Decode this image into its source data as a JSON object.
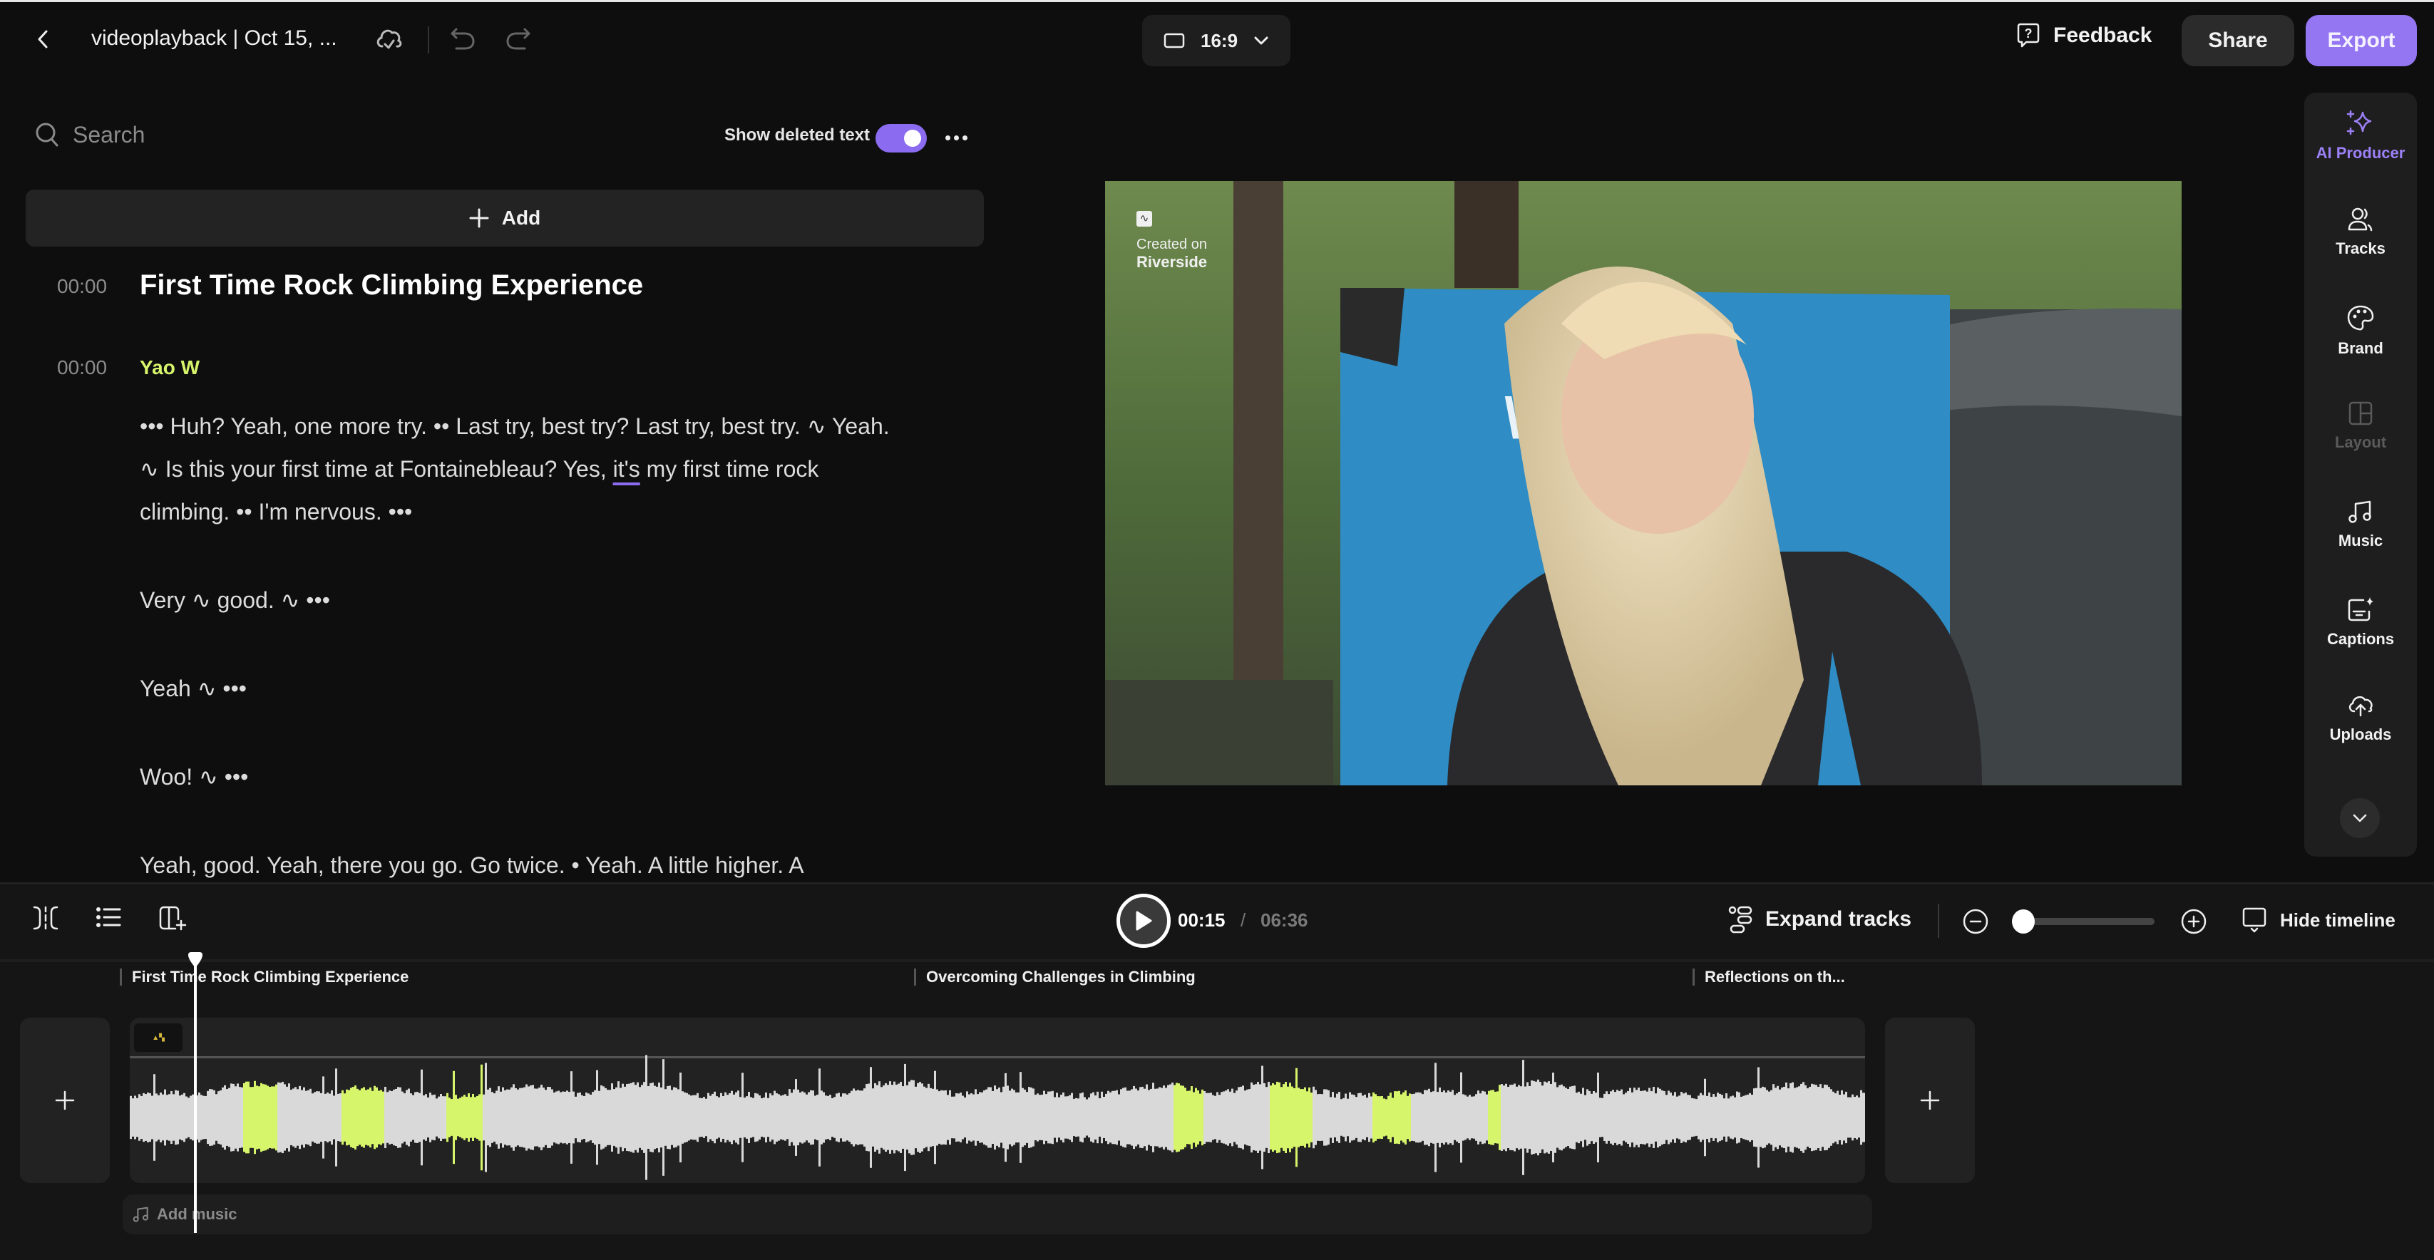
{
  "header": {
    "project_title": "videoplayback | Oct 15, ...",
    "aspect_ratio": "16:9",
    "feedback_label": "Feedback",
    "share_label": "Share",
    "export_label": "Export"
  },
  "colors": {
    "accent": "#9476f3",
    "speaker": "#d7f56b",
    "waveform_active": "#d7f56b",
    "waveform": "#d9d9d9"
  },
  "transcript": {
    "search_placeholder": "Search",
    "show_deleted_label": "Show deleted text",
    "show_deleted_on": true,
    "add_label": "Add",
    "chapter": {
      "time": "00:00",
      "title": "First Time Rock Climbing Experience"
    },
    "speaker": {
      "time": "00:00",
      "name": "Yao W"
    },
    "paragraphs": [
      {
        "before": "••• Huh? Yeah, one more try. •• Last try, best try? Last try, best try. ∿ Yeah. ∿ Is this your first time at Fontainebleau? Yes, ",
        "highlight": "it's",
        "after": " my first time rock climbing. •• I'm nervous. •••"
      },
      {
        "before": "Very ∿ good. ∿ •••",
        "highlight": "",
        "after": ""
      },
      {
        "before": "Yeah ∿ •••",
        "highlight": "",
        "after": ""
      },
      {
        "before": "Woo! ∿ •••",
        "highlight": "",
        "after": ""
      },
      {
        "before": "Yeah, good. Yeah, there you go. Go twice. • Yeah. A little higher. A",
        "highlight": "",
        "after": ""
      }
    ]
  },
  "video": {
    "watermark_line1": "Created on",
    "watermark_line2": "Riverside"
  },
  "rail": {
    "items": [
      {
        "label": "AI Producer",
        "icon": "sparkles-icon",
        "state": "active"
      },
      {
        "label": "Tracks",
        "icon": "people-icon",
        "state": "normal"
      },
      {
        "label": "Brand",
        "icon": "palette-icon",
        "state": "normal"
      },
      {
        "label": "Layout",
        "icon": "layout-icon",
        "state": "disabled"
      },
      {
        "label": "Music",
        "icon": "music-note-icon",
        "state": "normal"
      },
      {
        "label": "Captions",
        "icon": "captions-icon",
        "state": "normal"
      },
      {
        "label": "Uploads",
        "icon": "upload-cloud-icon",
        "state": "normal"
      }
    ]
  },
  "timeline": {
    "current_time": "00:15",
    "separator": "/",
    "total_time": "06:36",
    "progress_fraction": 0.038,
    "expand_tracks_label": "Expand tracks",
    "hide_timeline_label": "Hide timeline",
    "zoom_level_fraction": 0.0,
    "chapters": [
      {
        "title": "First Time Rock Climbing Experience"
      },
      {
        "title": "Overcoming Challenges in Climbing"
      },
      {
        "title": "Reflections on th..."
      }
    ],
    "add_music_label": "Add music"
  }
}
